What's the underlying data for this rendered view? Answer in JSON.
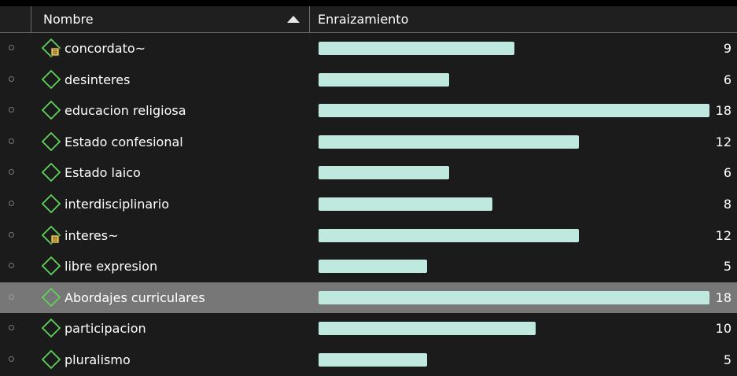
{
  "header": {
    "name_label": "Nombre",
    "root_label": "Enraizamiento"
  },
  "colors": {
    "bar": "#bfe8df",
    "icon_green": "#5fd35a",
    "selected_row": "#777777",
    "background": "#1b1b1b"
  },
  "max_value": 18,
  "rows": [
    {
      "name": "concordato~",
      "value": 9,
      "icon": "code-group-icon"
    },
    {
      "name": "desinteres",
      "value": 6,
      "icon": "code-icon"
    },
    {
      "name": "educacion religiosa",
      "value": 18,
      "icon": "code-icon"
    },
    {
      "name": "Estado confesional",
      "value": 12,
      "icon": "code-icon"
    },
    {
      "name": "Estado laico",
      "value": 6,
      "icon": "code-icon"
    },
    {
      "name": "interdisciplinario",
      "value": 8,
      "icon": "code-icon"
    },
    {
      "name": "interes~",
      "value": 12,
      "icon": "code-group-icon"
    },
    {
      "name": "libre expresion",
      "value": 5,
      "icon": "code-icon"
    },
    {
      "name": "Abordajes curriculares",
      "value": 18,
      "icon": "code-icon",
      "selected": true
    },
    {
      "name": "participacion",
      "value": 10,
      "icon": "code-icon"
    },
    {
      "name": "pluralismo",
      "value": 5,
      "icon": "code-icon"
    }
  ]
}
